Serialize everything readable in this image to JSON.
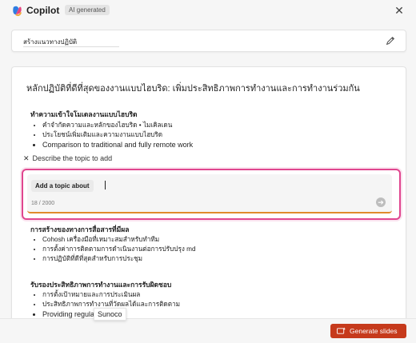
{
  "header": {
    "app_title": "Copilot",
    "badge": "AI generated",
    "close_label": "✕"
  },
  "title_card": {
    "value": "สร้างแนวทางปฏิบัติ"
  },
  "document": {
    "heading": "หลักปฏิบัติที่ดีที่สุดของงานแบบไฮบริด: เพิ่มประสิทธิภาพการทำงานและการทำงานร่วมกัน",
    "sections": [
      {
        "title": "ทำความเข้าใจโมเดลงานแบบไฮบริด",
        "items": [
          "คำจำกัดความและหลักของไฮบริด • ไมเคิลเดน",
          "ประโยชน์เพิ่มเติมและความงานแบบไฮบริด",
          "Comparison to traditional and fully remote work"
        ]
      },
      {
        "title": "การสร้างของทางการสื่อสารที่มีผล",
        "items": [
          "Cohosh เครื่องมือที่เหมาะสมสำหรับทำทีม",
          "การตั้งค่าการติดตามการดำเนินงานต่อการปรับปรุง md",
          "การปฏิบัติที่ดีที่สุดสำหรับการประชุม"
        ]
      },
      {
        "title": "รับรองประสิทธิภาพการทำงานและการรับผิดชอบ",
        "items": [
          "การตั้งเป้าหมายและการประเมินผล",
          "ประสิทธิภาพการทำงานที่วัดผลได้และการติดตาม",
          "Providing regular"
        ]
      }
    ]
  },
  "describe": {
    "label": "Describe the topic to add",
    "close_label": "✕"
  },
  "prompt": {
    "chip": "Add a topic about",
    "counter": "18 / 2000",
    "send_label": "➔"
  },
  "footer": {
    "generate_label": "Generate slides"
  },
  "tooltip": {
    "text": "Sunoco"
  },
  "colors": {
    "accent": "#c63a1c",
    "prompt_border": "#e0468f",
    "prompt_underline": "#e08a2c"
  }
}
